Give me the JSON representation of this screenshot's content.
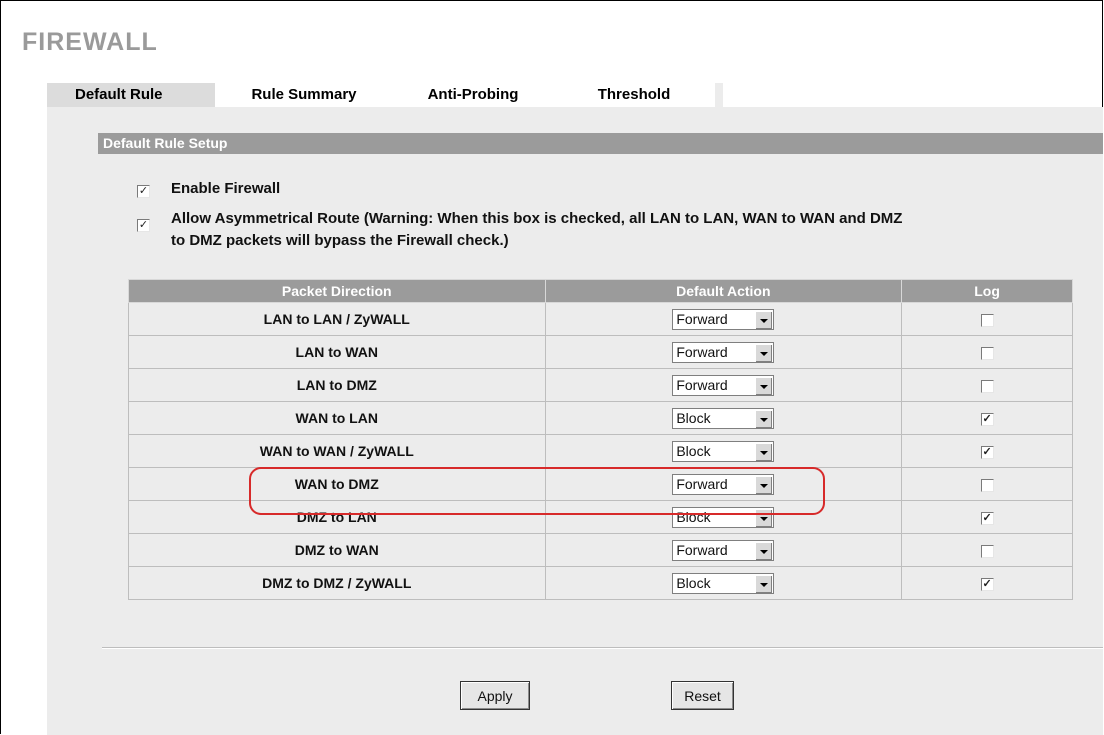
{
  "page": {
    "title": "FIREWALL"
  },
  "tabs": [
    {
      "label": "Default Rule",
      "active": true
    },
    {
      "label": "Rule Summary",
      "active": false
    },
    {
      "label": "Anti-Probing",
      "active": false
    },
    {
      "label": "Threshold",
      "active": false
    }
  ],
  "section": {
    "title": "Default Rule Setup"
  },
  "options": {
    "enable_firewall": {
      "label": "Enable Firewall",
      "checked": true
    },
    "asymmetrical": {
      "label_line1": "Allow Asymmetrical Route (Warning: When this box is checked, all LAN to LAN, WAN to WAN and DMZ",
      "label_line2": "to DMZ packets will bypass the Firewall check.)",
      "checked": true
    }
  },
  "table": {
    "headers": {
      "direction": "Packet Direction",
      "action": "Default Action",
      "log": "Log"
    },
    "rows": [
      {
        "direction": "LAN to LAN / ZyWALL",
        "action": "Forward",
        "log": false
      },
      {
        "direction": "LAN to WAN",
        "action": "Forward",
        "log": false
      },
      {
        "direction": "LAN to DMZ",
        "action": "Forward",
        "log": false
      },
      {
        "direction": "WAN to LAN",
        "action": "Block",
        "log": true
      },
      {
        "direction": "WAN to WAN / ZyWALL",
        "action": "Block",
        "log": true
      },
      {
        "direction": "WAN to DMZ",
        "action": "Forward",
        "log": false,
        "highlighted": true
      },
      {
        "direction": "DMZ to LAN",
        "action": "Block",
        "log": true
      },
      {
        "direction": "DMZ to WAN",
        "action": "Forward",
        "log": false
      },
      {
        "direction": "DMZ to DMZ / ZyWALL",
        "action": "Block",
        "log": true
      }
    ]
  },
  "buttons": {
    "apply": "Apply",
    "reset": "Reset"
  },
  "colors": {
    "highlight": "#d72a2a",
    "header_bg": "#9b9b9b",
    "panel_bg": "#ececec"
  }
}
